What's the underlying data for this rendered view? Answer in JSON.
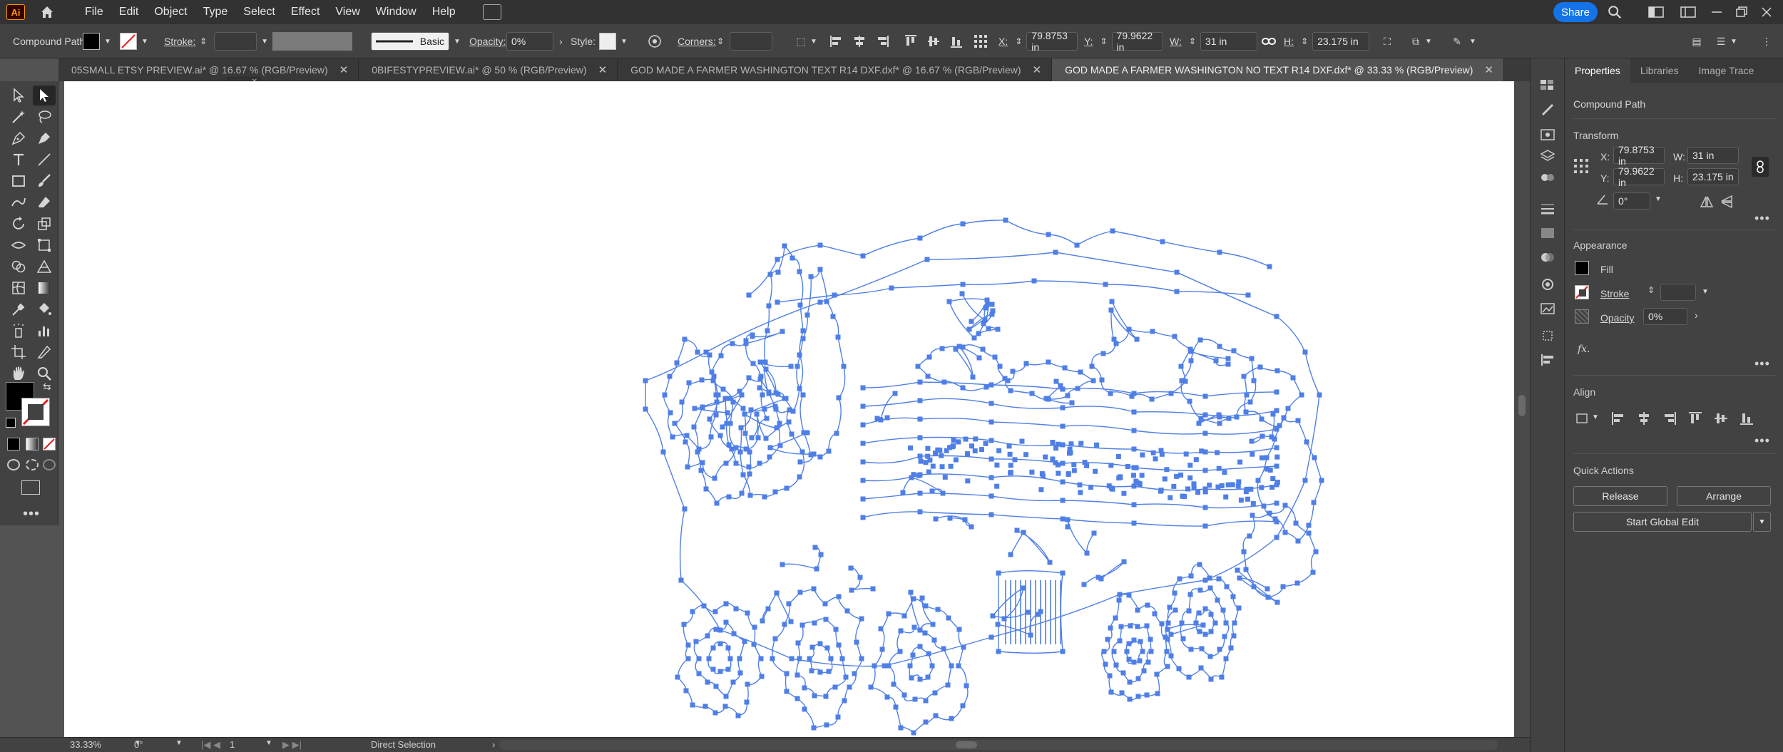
{
  "app": {
    "logo": "Ai",
    "menus": [
      "File",
      "Edit",
      "Object",
      "Type",
      "Select",
      "Effect",
      "View",
      "Window",
      "Help"
    ],
    "share_label": "Share"
  },
  "control_bar": {
    "selection_type": "Compound Path",
    "stroke_label": "Stroke:",
    "brush_label": "Basic",
    "opacity_label": "Opacity:",
    "opacity_value": "0%",
    "style_label": "Style:",
    "corners_label": "Corners:",
    "x_label": "X:",
    "x_value": "79.8753 in",
    "y_label": "Y:",
    "y_value": "79.9622 in",
    "w_label": "W:",
    "w_value": "31 in",
    "h_label": "H:",
    "h_value": "23.175 in"
  },
  "tabs": [
    {
      "label": "05SMALL ETSY PREVIEW.ai* @ 16.67 % (RGB/Preview)",
      "active": false
    },
    {
      "label": "0BIFESTYPREVIEW.ai* @ 50 % (RGB/Preview)",
      "active": false
    },
    {
      "label": "GOD MADE A FARMER WASHINGTON TEXT R14 DXF.dxf* @ 16.67 % (RGB/Preview)",
      "active": false
    },
    {
      "label": "GOD MADE A FARMER WASHINGTON NO TEXT R14 DXF.dxf* @ 33.33 % (RGB/Preview)",
      "active": true
    }
  ],
  "status": {
    "zoom": "33.33%",
    "rotation": "0°",
    "artboard": "1",
    "tool": "Direct Selection"
  },
  "properties": {
    "tabs": [
      "Properties",
      "Libraries",
      "Image Trace"
    ],
    "object_type": "Compound Path",
    "transform": {
      "title": "Transform",
      "x_label": "X:",
      "x": "79.8753 in",
      "y_label": "Y:",
      "y": "79.9622 in",
      "w_label": "W:",
      "w": "31 in",
      "h_label": "H:",
      "h": "23.175 in",
      "angle": "0°"
    },
    "appearance": {
      "title": "Appearance",
      "fill_label": "Fill",
      "stroke_label": "Stroke",
      "opacity_label": "Opacity",
      "opacity": "0%"
    },
    "align": {
      "title": "Align"
    },
    "quick_actions": {
      "title": "Quick Actions",
      "release": "Release",
      "arrange": "Arrange",
      "global_edit": "Start Global Edit"
    }
  },
  "colors": {
    "selection_blue": "#4f7fe6",
    "ui_dark": "#424242",
    "canvas": "#535353",
    "share": "#1473e6",
    "illustrator_orange": "#ff9a00"
  }
}
